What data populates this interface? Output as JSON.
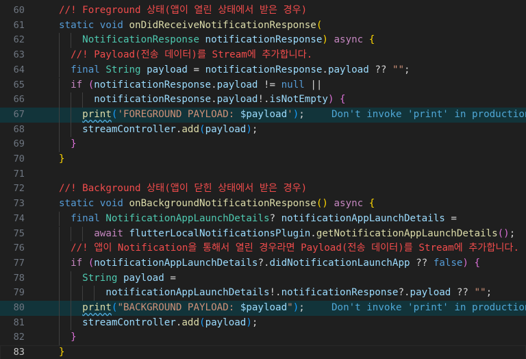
{
  "editor": {
    "lines": [
      {
        "n": "60",
        "tokens": [
          [
            "cm",
            "//! Foreground 상태(앱이 열린 상태에서 받은 경우)"
          ]
        ]
      },
      {
        "n": "61",
        "tokens": [
          [
            "kw",
            "static "
          ],
          [
            "kw",
            "void "
          ],
          [
            "fn",
            "onDidReceiveNotificationResponse"
          ],
          [
            "b1",
            "("
          ]
        ]
      },
      {
        "n": "62",
        "tokens": [
          [
            "pn",
            "    "
          ],
          [
            "ty",
            "NotificationResponse "
          ],
          [
            "vr",
            "notificationResponse"
          ],
          [
            "b1",
            ") "
          ],
          [
            "kc",
            "async "
          ],
          [
            "b1",
            "{"
          ]
        ]
      },
      {
        "n": "63",
        "tokens": [
          [
            "pn",
            "  "
          ],
          [
            "cm",
            "//! Payload(전송 데이터)를 Stream에 추가합니다."
          ]
        ]
      },
      {
        "n": "64",
        "tokens": [
          [
            "pn",
            "  "
          ],
          [
            "kw",
            "final "
          ],
          [
            "ty",
            "String "
          ],
          [
            "vr",
            "payload "
          ],
          [
            "pn",
            "= "
          ],
          [
            "vr",
            "notificationResponse"
          ],
          [
            "pn",
            "."
          ],
          [
            "vr",
            "payload "
          ],
          [
            "pn",
            "?? "
          ],
          [
            "st",
            "\"\""
          ],
          [
            "pn",
            ";"
          ]
        ]
      },
      {
        "n": "65",
        "tokens": [
          [
            "pn",
            "  "
          ],
          [
            "kc",
            "if "
          ],
          [
            "b2",
            "("
          ],
          [
            "vr",
            "notificationResponse"
          ],
          [
            "pn",
            "."
          ],
          [
            "vr",
            "payload "
          ],
          [
            "pn",
            "!= "
          ],
          [
            "kw",
            "null "
          ],
          [
            "pn",
            "||"
          ]
        ]
      },
      {
        "n": "66",
        "tokens": [
          [
            "pn",
            "      "
          ],
          [
            "vr",
            "notificationResponse"
          ],
          [
            "pn",
            "."
          ],
          [
            "vr",
            "payload"
          ],
          [
            "pn",
            "!."
          ],
          [
            "vr",
            "isNotEmpty"
          ],
          [
            "b2",
            ") "
          ],
          [
            "b2",
            "{"
          ]
        ]
      },
      {
        "n": "67",
        "tokens": [
          [
            "pn",
            "    "
          ],
          [
            "fn squig",
            "print"
          ],
          [
            "b3",
            "("
          ],
          [
            "st",
            "'FOREGROUND PAYLOAD: "
          ],
          [
            "vr",
            "$payload"
          ],
          [
            "st",
            "'"
          ],
          [
            "b3",
            ")"
          ],
          [
            "pn",
            ";"
          ]
        ],
        "lint": "Don't invoke 'print' in production code",
        "hl": true
      },
      {
        "n": "68",
        "tokens": [
          [
            "pn",
            "    "
          ],
          [
            "vr",
            "streamController"
          ],
          [
            "pn",
            "."
          ],
          [
            "fn",
            "add"
          ],
          [
            "b3",
            "("
          ],
          [
            "vr",
            "payload"
          ],
          [
            "b3",
            ")"
          ],
          [
            "pn",
            ";"
          ]
        ]
      },
      {
        "n": "69",
        "tokens": [
          [
            "pn",
            "  "
          ],
          [
            "b2",
            "}"
          ]
        ]
      },
      {
        "n": "70",
        "tokens": [
          [
            "b1",
            "}"
          ]
        ]
      },
      {
        "n": "71",
        "tokens": []
      },
      {
        "n": "72",
        "tokens": [
          [
            "cm",
            "//! Background 상태(앱이 닫힌 상태에서 받은 경우)"
          ]
        ]
      },
      {
        "n": "73",
        "tokens": [
          [
            "kw",
            "static "
          ],
          [
            "kw",
            "void "
          ],
          [
            "fn",
            "onBackgroundNotificationResponse"
          ],
          [
            "b1",
            "() "
          ],
          [
            "kc",
            "async "
          ],
          [
            "b1",
            "{"
          ]
        ]
      },
      {
        "n": "74",
        "tokens": [
          [
            "pn",
            "  "
          ],
          [
            "kw",
            "final "
          ],
          [
            "ty",
            "NotificationAppLaunchDetails"
          ],
          [
            "pn",
            "? "
          ],
          [
            "vr",
            "notificationAppLaunchDetails "
          ],
          [
            "pn",
            "="
          ]
        ]
      },
      {
        "n": "75",
        "tokens": [
          [
            "pn",
            "      "
          ],
          [
            "kc",
            "await "
          ],
          [
            "vr",
            "flutterLocalNotificationsPlugin"
          ],
          [
            "pn",
            "."
          ],
          [
            "fn",
            "getNotificationAppLaunchDetails"
          ],
          [
            "b2",
            "()"
          ],
          [
            "pn",
            ";"
          ]
        ]
      },
      {
        "n": "76",
        "tokens": [
          [
            "pn",
            "  "
          ],
          [
            "cm",
            "//! 앱이 Notification을 통해서 열린 경우라면 Payload(전송 데이터)를 Stream에 추가합니다."
          ]
        ]
      },
      {
        "n": "77",
        "tokens": [
          [
            "pn",
            "  "
          ],
          [
            "kc",
            "if "
          ],
          [
            "b2",
            "("
          ],
          [
            "vr",
            "notificationAppLaunchDetails"
          ],
          [
            "pn",
            "?."
          ],
          [
            "vr",
            "didNotificationLaunchApp "
          ],
          [
            "pn",
            "?? "
          ],
          [
            "kw",
            "false"
          ],
          [
            "b2",
            ") "
          ],
          [
            "b2",
            "{"
          ]
        ]
      },
      {
        "n": "78",
        "tokens": [
          [
            "pn",
            "    "
          ],
          [
            "ty",
            "String "
          ],
          [
            "vr",
            "payload "
          ],
          [
            "pn",
            "="
          ]
        ]
      },
      {
        "n": "79",
        "tokens": [
          [
            "pn",
            "        "
          ],
          [
            "vr",
            "notificationAppLaunchDetails"
          ],
          [
            "pn",
            "!."
          ],
          [
            "vr",
            "notificationResponse"
          ],
          [
            "pn",
            "?."
          ],
          [
            "vr",
            "payload "
          ],
          [
            "pn",
            "?? "
          ],
          [
            "st",
            "\"\""
          ],
          [
            "pn",
            ";"
          ]
        ]
      },
      {
        "n": "80",
        "tokens": [
          [
            "pn",
            "    "
          ],
          [
            "fn squig",
            "print"
          ],
          [
            "b3",
            "("
          ],
          [
            "st",
            "\"BACKGROUND PAYLOAD: "
          ],
          [
            "vr",
            "$payload"
          ],
          [
            "st",
            "\""
          ],
          [
            "b3",
            ")"
          ],
          [
            "pn",
            ";"
          ]
        ],
        "lint": "Don't invoke 'print' in production code",
        "hl": true
      },
      {
        "n": "81",
        "tokens": [
          [
            "pn",
            "    "
          ],
          [
            "vr",
            "streamController"
          ],
          [
            "pn",
            "."
          ],
          [
            "fn",
            "add"
          ],
          [
            "b3",
            "("
          ],
          [
            "vr",
            "payload"
          ],
          [
            "b3",
            ")"
          ],
          [
            "pn",
            ";"
          ]
        ]
      },
      {
        "n": "82",
        "tokens": [
          [
            "pn",
            "  "
          ],
          [
            "b2",
            "}"
          ]
        ]
      },
      {
        "n": "83",
        "tokens": [
          [
            "b1",
            "}"
          ]
        ],
        "current": true
      }
    ]
  }
}
